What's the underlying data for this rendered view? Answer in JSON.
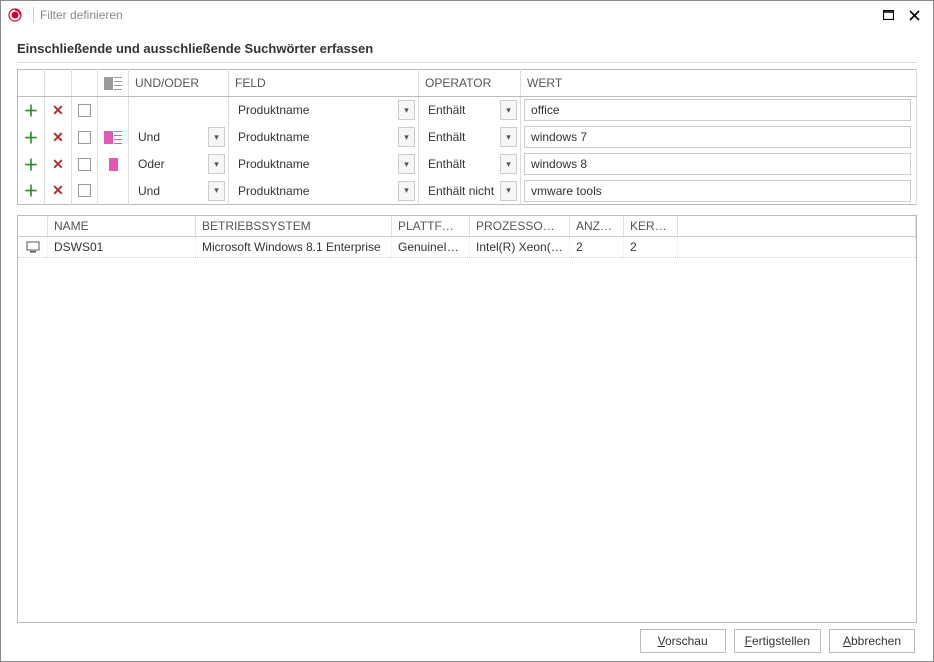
{
  "window": {
    "title": "Filter definieren",
    "instruction": "Einschließende und ausschließende Suchwörter erfassen"
  },
  "filter_columns": {
    "andor": "UND/ODER",
    "feld": "FELD",
    "operator": "OPERATOR",
    "wert": "WERT"
  },
  "filters": [
    {
      "indicator": false,
      "andor": "",
      "feld": "Produktname",
      "operator": "Enthält",
      "wert": "office"
    },
    {
      "indicator": true,
      "andor": "Und",
      "feld": "Produktname",
      "operator": "Enthält",
      "wert": "windows 7"
    },
    {
      "indicator": true,
      "andor": "Oder",
      "feld": "Produktname",
      "operator": "Enthält",
      "wert": "windows 8"
    },
    {
      "indicator": false,
      "andor": "Und",
      "feld": "Produktname",
      "operator": "Enthält nicht",
      "wert": "vmware tools"
    }
  ],
  "results_columns": {
    "name": "NAME",
    "os": "BETRIEBSSYSTEM",
    "platform": "PLATTFORM",
    "processor": "PROZESSORNA...",
    "count": "ANZA...",
    "cores": "KERNE"
  },
  "results": [
    {
      "name": "DSWS01",
      "os": "Microsoft Windows 8.1 Enterprise",
      "platform": "GenuineIntel",
      "processor": "Intel(R) Xeon(R)...",
      "count": "2",
      "cores": "2"
    }
  ],
  "buttons": {
    "preview_u": "V",
    "preview_rest": "orschau",
    "finish_u": "F",
    "finish_rest": "ertigstellen",
    "cancel_u": "A",
    "cancel_rest": "bbrechen"
  }
}
